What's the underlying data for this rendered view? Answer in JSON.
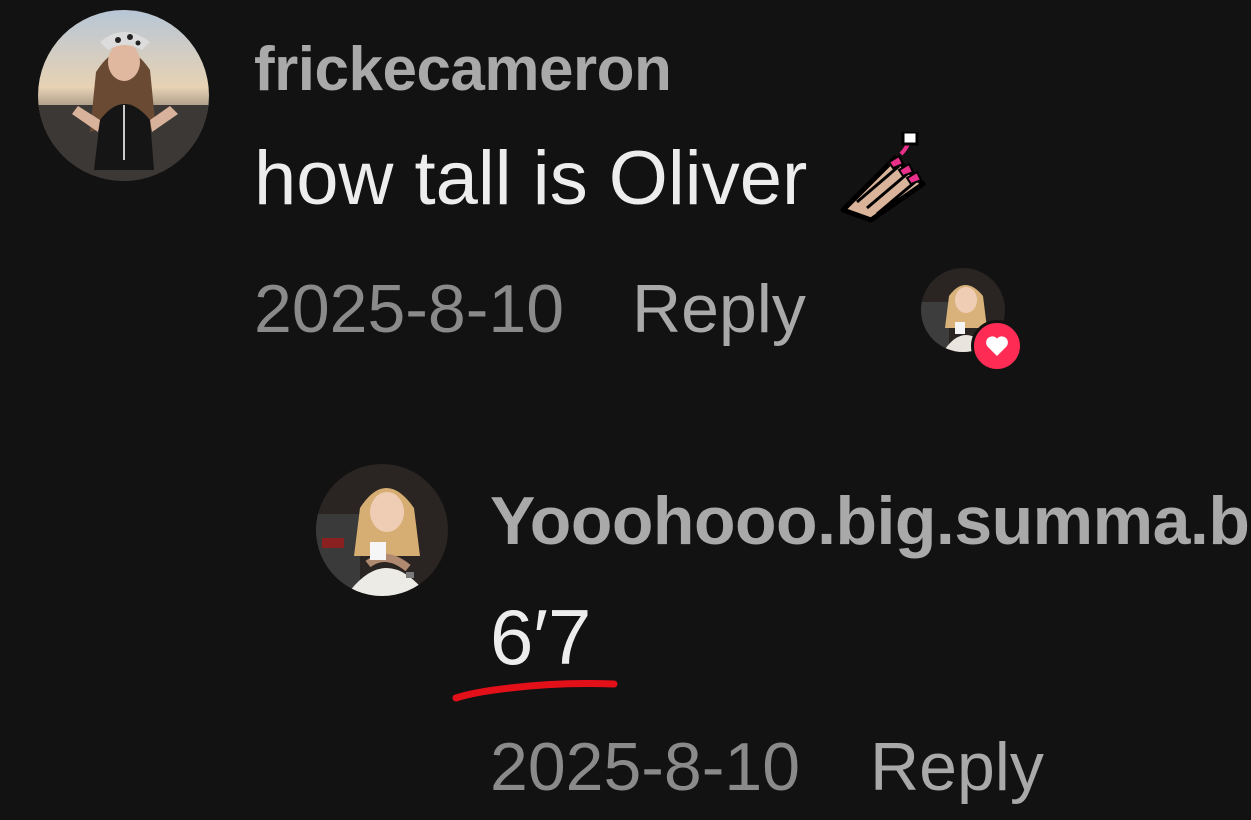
{
  "comment": {
    "username": "frickecameron",
    "text": "how tall is Oliver",
    "emoji_icon": "nail-polish-icon",
    "date": "2025-8-10",
    "reply_label": "Reply",
    "liked_by_creator": true
  },
  "reply": {
    "username": "Yooohooo.big.summa.b",
    "text": "6′7",
    "date": "2025-8-10",
    "reply_label": "Reply"
  },
  "colors": {
    "background": "#121212",
    "username": "#a9a9a9",
    "date": "#8a8a8a",
    "heart_badge": "#fe2c55",
    "annotation_underline": "#e3101a"
  }
}
